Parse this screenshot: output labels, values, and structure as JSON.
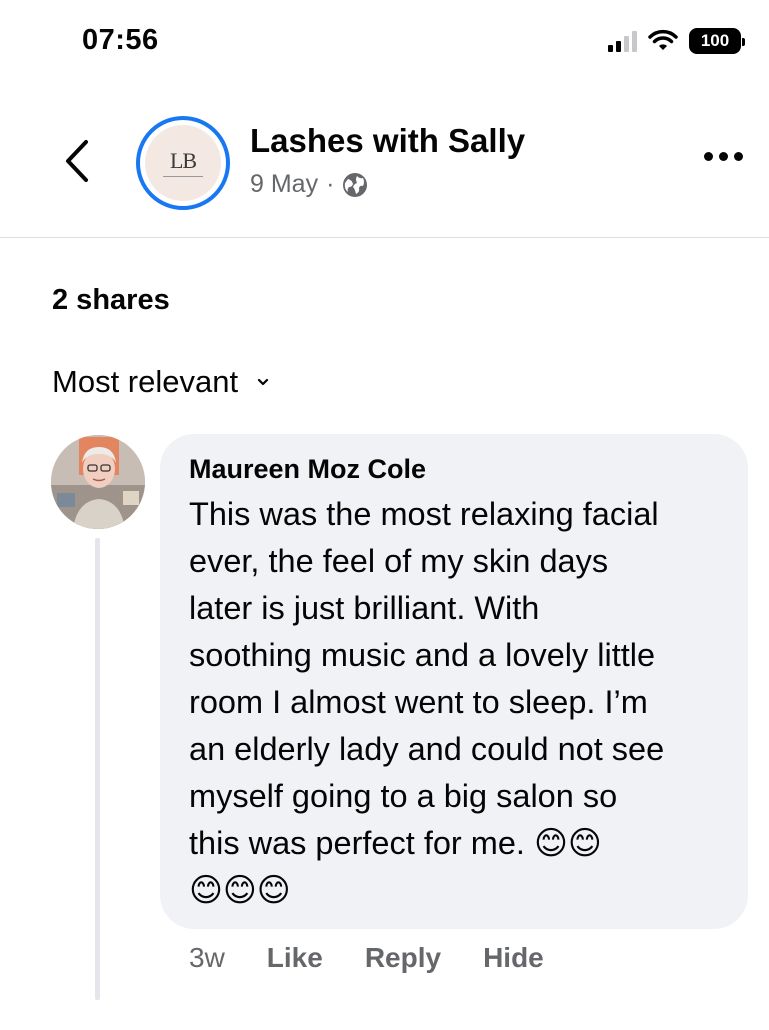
{
  "status_bar": {
    "time": "07:56",
    "battery": "100"
  },
  "header": {
    "page_name": "Lashes with Sally",
    "date": "9 May",
    "separator": "·",
    "logo_text": "LB"
  },
  "post": {
    "shares": "2 shares"
  },
  "comments_sort": {
    "label": "Most relevant"
  },
  "comment": {
    "author": "Maureen Moz Cole",
    "text": "This was the most relaxing facial\never, the feel of my skin days\nlater is just brilliant. With\nsoothing music and a lovely little\nroom I almost went to sleep. I’m\nan elderly lady and could not see\nmyself going to a big salon so\nthis was perfect for me. 😊😊\n😊😊😊",
    "time": "3w",
    "like_label": "Like",
    "reply_label": "Reply",
    "hide_label": "Hide"
  },
  "icons": {
    "back": "chevron-left-icon",
    "more": "more-horizontal-icon",
    "audience": "globe-icon",
    "sort": "chevron-down-icon",
    "signal": "cellular-signal-icon",
    "wifi": "wifi-icon",
    "battery": "battery-icon"
  },
  "colors": {
    "accent": "#1877f2",
    "secondary_text": "#65676b",
    "bubble_bg": "#f0f2f5"
  }
}
